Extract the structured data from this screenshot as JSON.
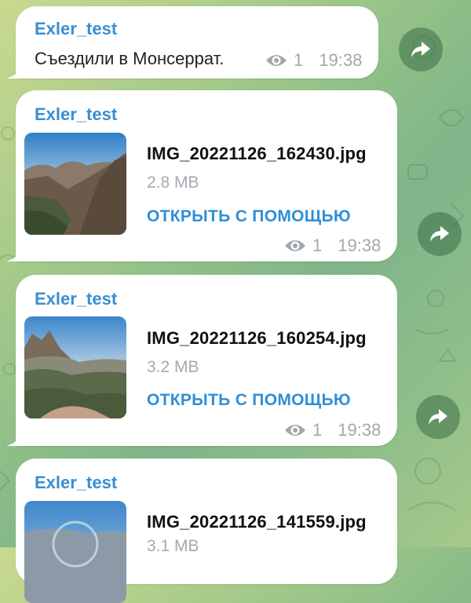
{
  "messages": [
    {
      "sender": "Exler_test",
      "text": "Съездили в Монсеррат.",
      "views": "1",
      "time": "19:38"
    },
    {
      "sender": "Exler_test",
      "file_name": "IMG_20221126_162430.jpg",
      "file_size": "2.8 MB",
      "open_label": "ОТКРЫТЬ С ПОМОЩЬЮ",
      "views": "1",
      "time": "19:38"
    },
    {
      "sender": "Exler_test",
      "file_name": "IMG_20221126_160254.jpg",
      "file_size": "3.2 MB",
      "open_label": "ОТКРЫТЬ С ПОМОЩЬЮ",
      "views": "1",
      "time": "19:38"
    },
    {
      "sender": "Exler_test",
      "file_name": "IMG_20221126_141559.jpg",
      "file_size": "3.1 MB"
    }
  ],
  "icons": {
    "views": "eye-icon",
    "forward": "forward-arrow-icon"
  },
  "colors": {
    "sender": "#3a8ed0",
    "link": "#2f8fd8",
    "meta": "#a0a8ad",
    "bubble": "#ffffff"
  }
}
